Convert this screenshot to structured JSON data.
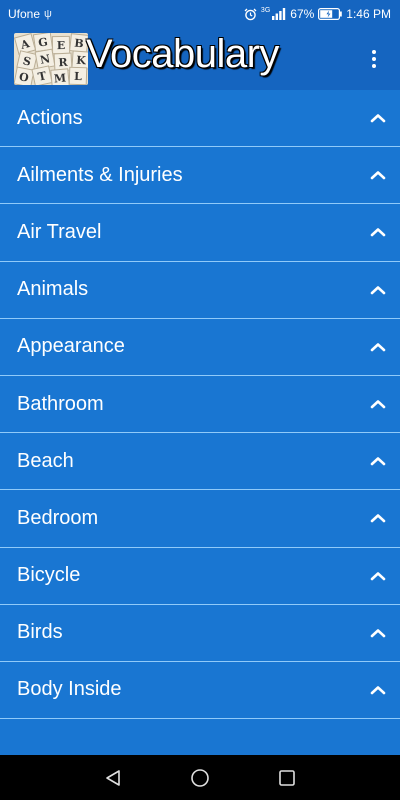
{
  "status_bar": {
    "carrier": "Ufone",
    "network": "3G",
    "battery": "67%",
    "time": "1:46 PM"
  },
  "app_bar": {
    "title": "Vocabulary",
    "logo_letters": [
      "A",
      "G",
      "E",
      "B",
      "S",
      "N",
      "R",
      "K",
      "O",
      "T",
      "M",
      "L"
    ]
  },
  "categories": [
    {
      "label": "Actions"
    },
    {
      "label": "Ailments & Injuries"
    },
    {
      "label": "Air Travel"
    },
    {
      "label": "Animals"
    },
    {
      "label": "Appearance"
    },
    {
      "label": "Bathroom"
    },
    {
      "label": "Beach"
    },
    {
      "label": "Bedroom"
    },
    {
      "label": "Bicycle"
    },
    {
      "label": "Birds"
    },
    {
      "label": "Body Inside"
    }
  ],
  "colors": {
    "app_bar": "#1565c0",
    "list_background": "#1976d2",
    "divider": "#90caf9",
    "nav_bar": "#000000"
  },
  "icons": {
    "item_toggle": "chevron-up-icon",
    "menu": "overflow-menu-icon",
    "nav": [
      "back-icon",
      "home-icon",
      "recents-icon"
    ]
  }
}
